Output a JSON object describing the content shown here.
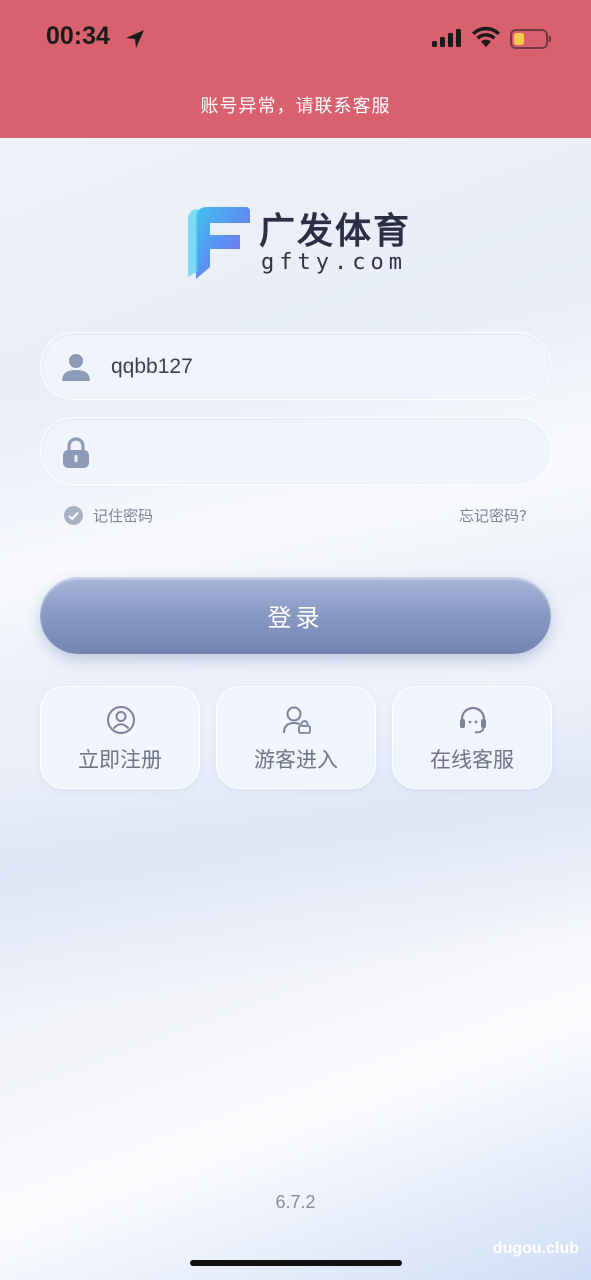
{
  "status_bar": {
    "time": "00:34"
  },
  "notice": "账号异常，请联系客服",
  "brand": {
    "name": "广发体育",
    "domain": "gfty.com"
  },
  "login_form": {
    "username": {
      "value": "qqbb127",
      "icon": "user-icon"
    },
    "password": {
      "value": "",
      "icon": "lock-icon"
    },
    "remember_label": "记住密码",
    "forgot_label": "忘记密码?",
    "submit_label": "登录"
  },
  "quick_actions": [
    {
      "label": "立即注册",
      "icon": "user-circle-icon"
    },
    {
      "label": "游客进入",
      "icon": "guest-icon"
    },
    {
      "label": "在线客服",
      "icon": "headset-icon"
    }
  ],
  "version": "6.7.2",
  "watermark": "dugou.club",
  "colors": {
    "header": "#d9616e",
    "button": "#8c9dc7"
  }
}
